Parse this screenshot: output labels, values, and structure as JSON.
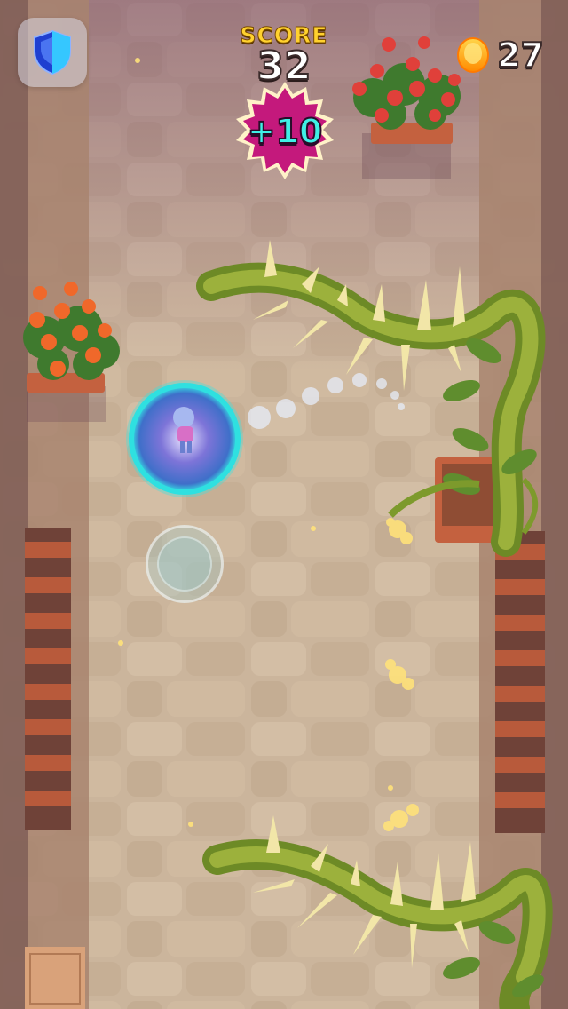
{
  "hud": {
    "score_label": "SCORE",
    "score_value": "32",
    "bonus_text": "+10",
    "coin_count": "27"
  },
  "icons": {
    "shield": "shield-icon",
    "coin": "coin-icon",
    "joystick": "joystick"
  },
  "colors": {
    "score_label": "#ffd12e",
    "bonus_badge": "#c4197c",
    "bonus_text": "#3ff0e6",
    "bubble": "#2fe0e0",
    "vine": "#7d9a2c"
  }
}
